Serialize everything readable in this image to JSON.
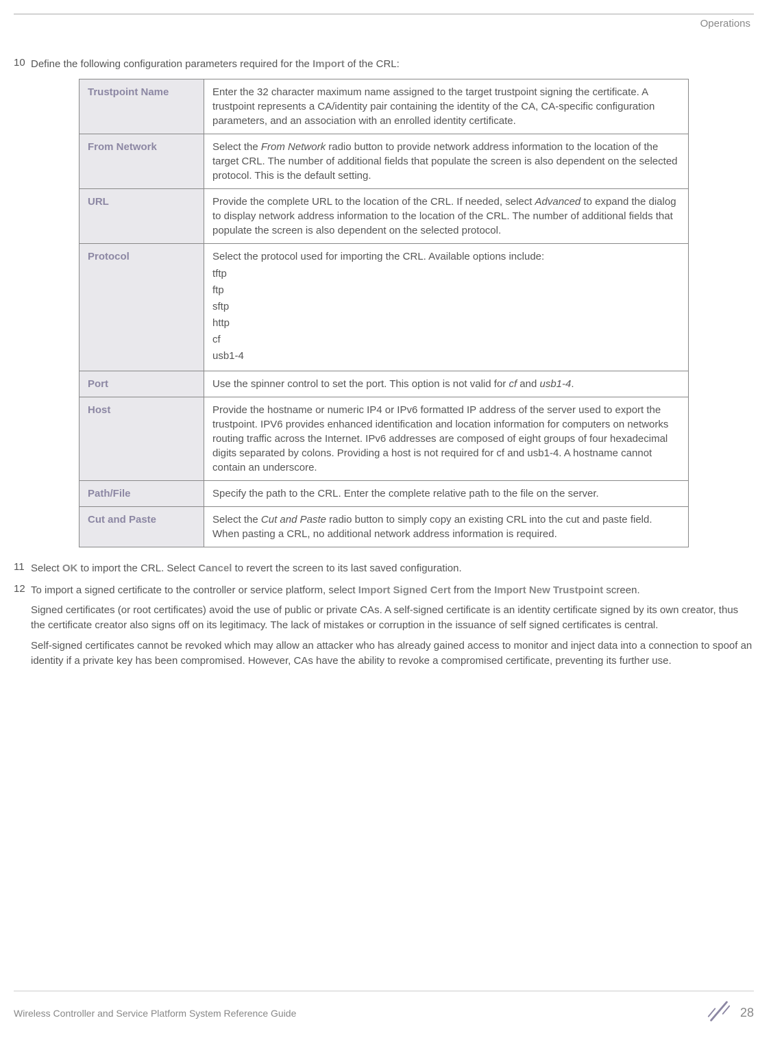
{
  "header": {
    "section": "Operations"
  },
  "steps": {
    "s10": {
      "num": "10",
      "text_pre": "Define the following configuration parameters required for the ",
      "bold": "Import",
      "text_post": " of the CRL:"
    },
    "s11": {
      "num": "11",
      "pre": "Select ",
      "ok": "OK",
      "mid": " to import the CRL. Select ",
      "cancel": "Cancel",
      "post": " to revert the screen to its last saved configuration."
    },
    "s12": {
      "num": "12",
      "pre": "To import a signed certificate to the controller or service platform, select ",
      "bold1": "Import Signed Cert",
      "mid": " from the ",
      "bold2": "Import New Trustpoint",
      "post": " screen.",
      "para2": "Signed certificates (or root certificates) avoid the use of public or private CAs. A self-signed certificate is an identity certificate signed by its own creator, thus the certificate creator also signs off on its legitimacy. The lack of mistakes or corruption in the issuance of self signed certificates is central.",
      "para3": "Self-signed certificates cannot be revoked which may allow an attacker who has already gained access to monitor and inject data into a connection to spoof an identity if a private key has been compromised. However, CAs have the ability to revoke a compromised certificate, preventing its further use."
    }
  },
  "table": {
    "rows": [
      {
        "label": "Trustpoint Name",
        "desc": "Enter the 32 character maximum name assigned to the target trustpoint signing the certificate. A trustpoint represents a CA/identity pair containing the identity of the CA, CA-specific configuration parameters, and an association with an enrolled identity certificate."
      },
      {
        "label": "From Network",
        "desc_pre": "Select the ",
        "desc_em": "From Network",
        "desc_post": " radio button to provide network address information to the location of the target CRL. The number of additional fields that populate the screen is also dependent on the selected protocol. This is the default setting."
      },
      {
        "label": "URL",
        "desc_pre": "Provide the complete URL to the location of the CRL. If needed, select ",
        "desc_em": "Advanced",
        "desc_post": " to expand the dialog to display network address information to the location of the CRL. The number of additional fields that populate the screen is also dependent on the selected protocol."
      },
      {
        "label": "Protocol",
        "desc_pre": "Select the protocol used for importing the CRL. Available options include:",
        "protocols": [
          "tftp",
          "ftp",
          "sftp",
          "http",
          "cf",
          "usb1-4"
        ]
      },
      {
        "label": "Port",
        "desc_pre": "Use the spinner control to set the port. This option is not valid for ",
        "desc_em": "cf",
        "desc_mid": " and ",
        "desc_em2": "usb1-4",
        "desc_post": "."
      },
      {
        "label": "Host",
        "desc": "Provide the hostname or numeric IP4 or IPv6 formatted IP address of the server used to export the trustpoint. IPV6 provides enhanced identification and location information for computers on networks routing traffic across the Internet. IPv6 addresses are composed of eight groups of four hexadecimal digits separated by colons. Providing a host is not required for cf and usb1-4. A hostname cannot contain an underscore."
      },
      {
        "label": "Path/File",
        "desc": "Specify the path to the CRL. Enter the complete relative path to the file on the server."
      },
      {
        "label": "Cut and Paste",
        "desc_pre": "Select the ",
        "desc_em": "Cut and Paste",
        "desc_post": " radio button to simply copy an existing CRL into the cut and paste field. When pasting a CRL, no additional network address information is required."
      }
    ]
  },
  "footer": {
    "guide": "Wireless Controller and Service Platform System Reference Guide",
    "page": "28"
  }
}
